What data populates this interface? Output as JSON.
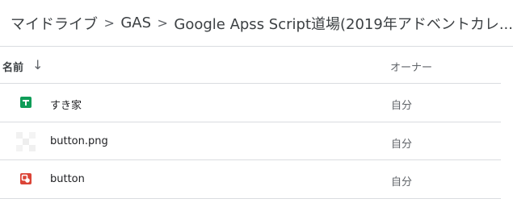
{
  "breadcrumb": {
    "root": "マイドライブ",
    "items": [
      "GAS",
      "Google Apss Script道場(2019年アドベントカレ..."
    ],
    "separator": ">"
  },
  "table": {
    "headers": {
      "name": "名前",
      "sort_arrow": "↓",
      "owner": "オーナー"
    },
    "rows": [
      {
        "name": "すき家",
        "owner": "自分",
        "icon": "google-sheets-icon",
        "color": "#0f9d58"
      },
      {
        "name": "button.png",
        "owner": "自分",
        "icon": "image-thumbnail-icon",
        "color": "#e0e0e0"
      },
      {
        "name": "button",
        "owner": "自分",
        "icon": "google-drawings-icon",
        "color": "#db4437"
      }
    ]
  }
}
